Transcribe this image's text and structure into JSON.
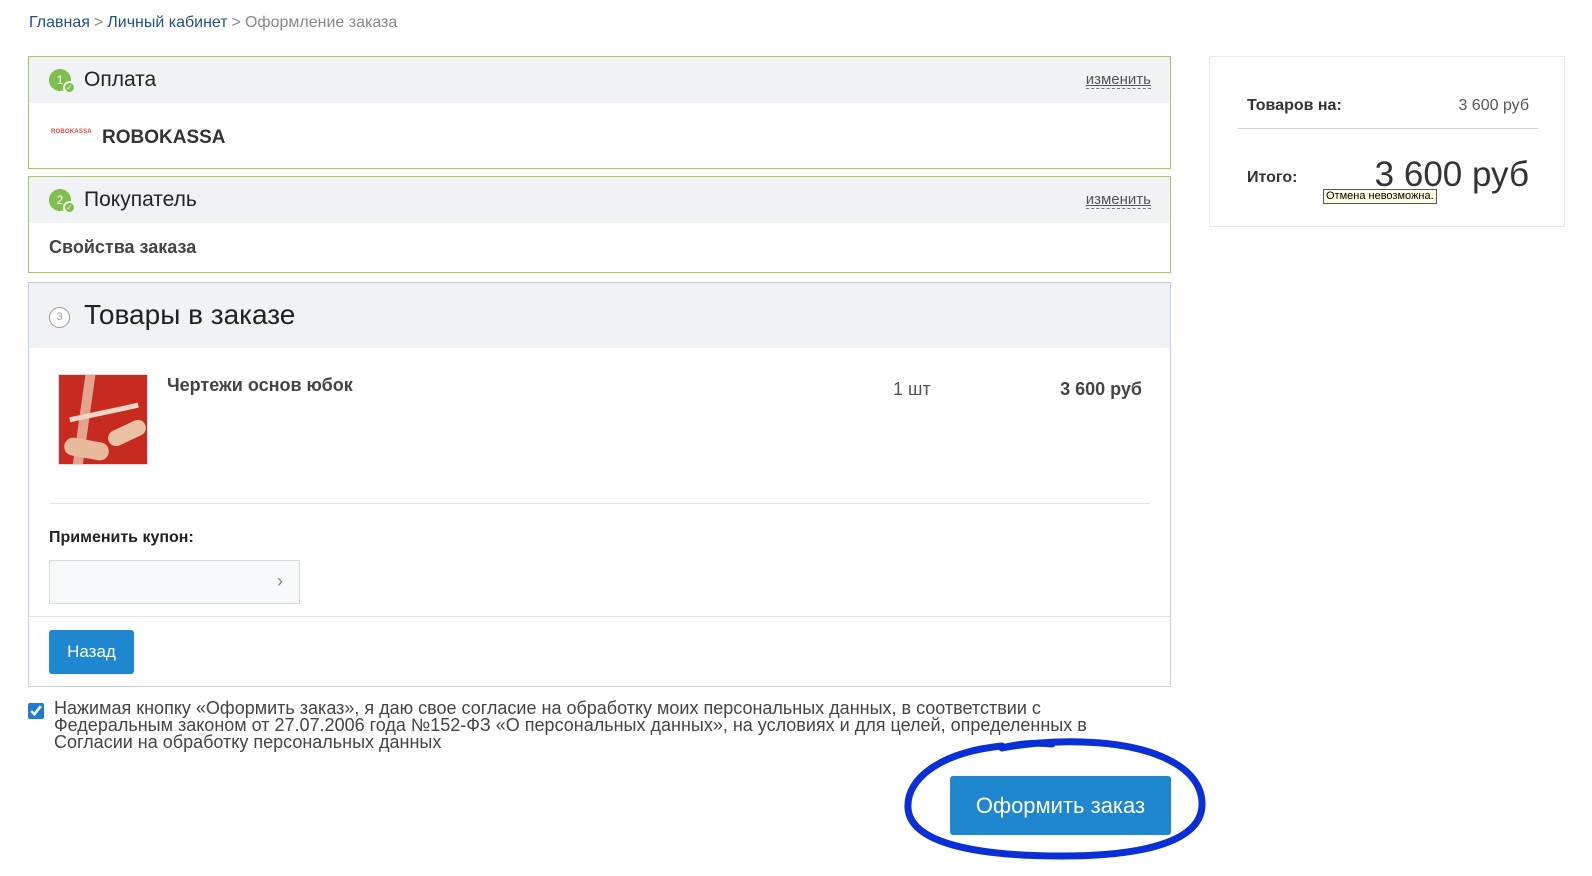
{
  "breadcrumb": {
    "home": "Главная",
    "separator": ">",
    "account": "Личный кабинет",
    "current": "Оформление заказа"
  },
  "payment": {
    "step": "1",
    "title": "Оплата",
    "change_label": "изменить",
    "logo_text": "ROBOKASSA",
    "method_name": "ROBOKASSA"
  },
  "buyer": {
    "step": "2",
    "title": "Покупатель",
    "change_label": "изменить",
    "properties_label": "Свойства заказа"
  },
  "goods": {
    "step": "3",
    "title": "Товары в заказе",
    "items": [
      {
        "name": "Чертежи основ юбок",
        "quantity": "1 шт",
        "price": "3 600 руб"
      }
    ],
    "coupon_label": "Применить купон:",
    "coupon_value": "",
    "coupon_arrow": "›",
    "back_label": "Назад"
  },
  "consent": {
    "checked": true,
    "text": "Нажимая кнопку «Оформить заказ», я даю свое согласие на обработку моих персональных данных, в соответствии с Федеральным законом от 27.07.2006 года №152-ФЗ «О персональных данных», на условиях и для целей, определенных в Согласии на обработку персональных данных"
  },
  "submit_label": "Оформить заказ",
  "summary": {
    "goods_label": "Товаров на:",
    "goods_value": "3 600 руб",
    "total_label": "Итого:",
    "total_value": "3 600 руб"
  },
  "tooltip": "Отмена невозможна.",
  "colors": {
    "accent_blue": "#1f87cf",
    "step_green": "#7cc04b",
    "border_green": "#a6c95b",
    "link_blue": "#1f4f8a",
    "highlight_circle": "#0a2fd6"
  }
}
